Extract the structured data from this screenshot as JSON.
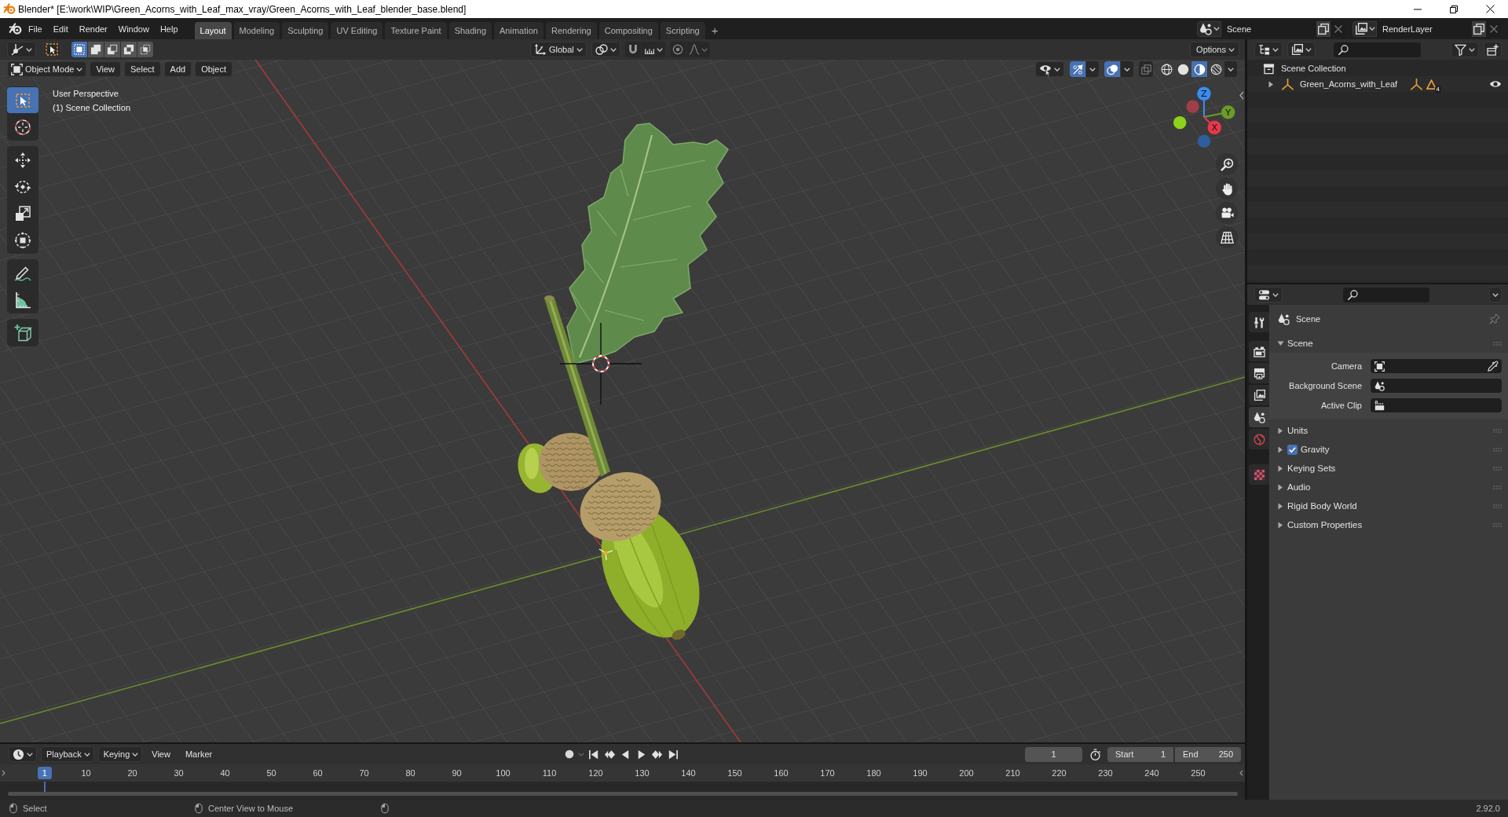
{
  "window": {
    "title": "Blender* [E:\\work\\WIP\\Green_Acorns_with_Leaf_max_vray/Green_Acorns_with_Leaf_blender_base.blend]"
  },
  "topbar": {
    "menus": [
      "File",
      "Edit",
      "Render",
      "Window",
      "Help"
    ],
    "workspaces": [
      {
        "label": "Layout",
        "selected": true
      },
      {
        "label": "Modeling",
        "selected": false
      },
      {
        "label": "Sculpting",
        "selected": false
      },
      {
        "label": "UV Editing",
        "selected": false
      },
      {
        "label": "Texture Paint",
        "selected": false
      },
      {
        "label": "Shading",
        "selected": false
      },
      {
        "label": "Animation",
        "selected": false
      },
      {
        "label": "Rendering",
        "selected": false
      },
      {
        "label": "Compositing",
        "selected": false
      },
      {
        "label": "Scripting",
        "selected": false
      }
    ],
    "add_workspace": "+",
    "scene": "Scene",
    "view_layer": "RenderLayer"
  },
  "viewport": {
    "select_modes": [
      {
        "kind": "set",
        "selected": true
      },
      {
        "kind": "extend",
        "selected": false
      },
      {
        "kind": "subtract",
        "selected": false
      },
      {
        "kind": "difference",
        "selected": false
      },
      {
        "kind": "intersect",
        "selected": false
      }
    ],
    "orientation": "Global",
    "options": "Options",
    "mode": "Object Mode",
    "menus": [
      "View",
      "Select",
      "Add",
      "Object"
    ],
    "gizmos_on": true,
    "overlays_on": true,
    "xray_on": false,
    "shading": [
      {
        "kind": "wireframe",
        "selected": false
      },
      {
        "kind": "solid",
        "selected": false
      },
      {
        "kind": "material",
        "selected": true
      },
      {
        "kind": "rendered",
        "selected": false
      }
    ],
    "info": [
      "User Perspective",
      "(1) Scene Collection"
    ],
    "tool_groups": [
      [
        {
          "kind": "select_box",
          "selected": true
        },
        {
          "kind": "cursor",
          "selected": false
        }
      ],
      [
        {
          "kind": "move",
          "selected": false
        },
        {
          "kind": "rotate",
          "selected": false
        },
        {
          "kind": "scale",
          "selected": false
        },
        {
          "kind": "transform",
          "selected": false
        }
      ],
      [
        {
          "kind": "annotate",
          "selected": false
        },
        {
          "kind": "measure",
          "selected": false
        }
      ],
      [
        {
          "kind": "add_cube",
          "selected": false
        }
      ]
    ],
    "axes": [
      {
        "label": "Z",
        "color": "#3a8cf0"
      },
      {
        "label": "Y",
        "color": "#6c9b26"
      },
      {
        "label": "X",
        "color": "#e8374f"
      }
    ],
    "negative_axes": [
      {
        "color": "#a03d4b"
      },
      {
        "color": "#8cd11b"
      },
      {
        "color": "#2e5e9d"
      }
    ]
  },
  "outliner": {
    "tree": [
      {
        "label": "Scene Collection",
        "kind": "collection",
        "children": [
          {
            "label": "Green_Acorns_with_Leaf",
            "kind": "empty",
            "expanded": false,
            "visible": true,
            "mesh_count": "4"
          }
        ]
      }
    ]
  },
  "properties": {
    "tab_groups": [
      [
        {
          "kind": "tool",
          "selected": false
        }
      ],
      [
        {
          "kind": "render",
          "selected": false
        },
        {
          "kind": "output",
          "selected": false
        },
        {
          "kind": "view_layer",
          "selected": false
        },
        {
          "kind": "scene",
          "selected": true
        },
        {
          "kind": "world",
          "selected": false
        }
      ],
      [
        {
          "kind": "texture",
          "selected": false
        }
      ]
    ],
    "context": "Scene",
    "panels": [
      {
        "title": "Scene",
        "kind": "plain",
        "expanded": true,
        "fields": [
          {
            "label": "Camera",
            "kind": "camera"
          },
          {
            "label": "Background Scene",
            "kind": "scene"
          },
          {
            "label": "Active Clip",
            "kind": "clip"
          }
        ]
      },
      {
        "title": "Units",
        "kind": "plain",
        "expanded": false
      },
      {
        "title": "Gravity",
        "kind": "toggle",
        "expanded": false,
        "checked": true
      },
      {
        "title": "Keying Sets",
        "kind": "plain",
        "expanded": false
      },
      {
        "title": "Audio",
        "kind": "plain",
        "expanded": false
      },
      {
        "title": "Rigid Body World",
        "kind": "plain",
        "expanded": false
      },
      {
        "title": "Custom Properties",
        "kind": "plain",
        "expanded": false
      }
    ]
  },
  "timeline": {
    "menus": [
      {
        "label": "Playback",
        "kind": "dropdown"
      },
      {
        "label": "Keying",
        "kind": "dropdown"
      },
      {
        "label": "View",
        "kind": "menu"
      },
      {
        "label": "Marker",
        "kind": "menu"
      }
    ],
    "auto_keying_on": false,
    "current_frame": "1",
    "start_label": "Start",
    "start": "1",
    "end_label": "End",
    "end": "250",
    "ruler": [
      "10",
      "20",
      "30",
      "40",
      "50",
      "60",
      "70",
      "80",
      "90",
      "100",
      "110",
      "120",
      "130",
      "140",
      "150",
      "160",
      "170",
      "180",
      "190",
      "200",
      "210",
      "220",
      "230",
      "240",
      "250"
    ],
    "playhead": "1"
  },
  "status_bar": {
    "hints": [
      "Select",
      "Center View to Mouse"
    ],
    "version": "2.92.0"
  }
}
